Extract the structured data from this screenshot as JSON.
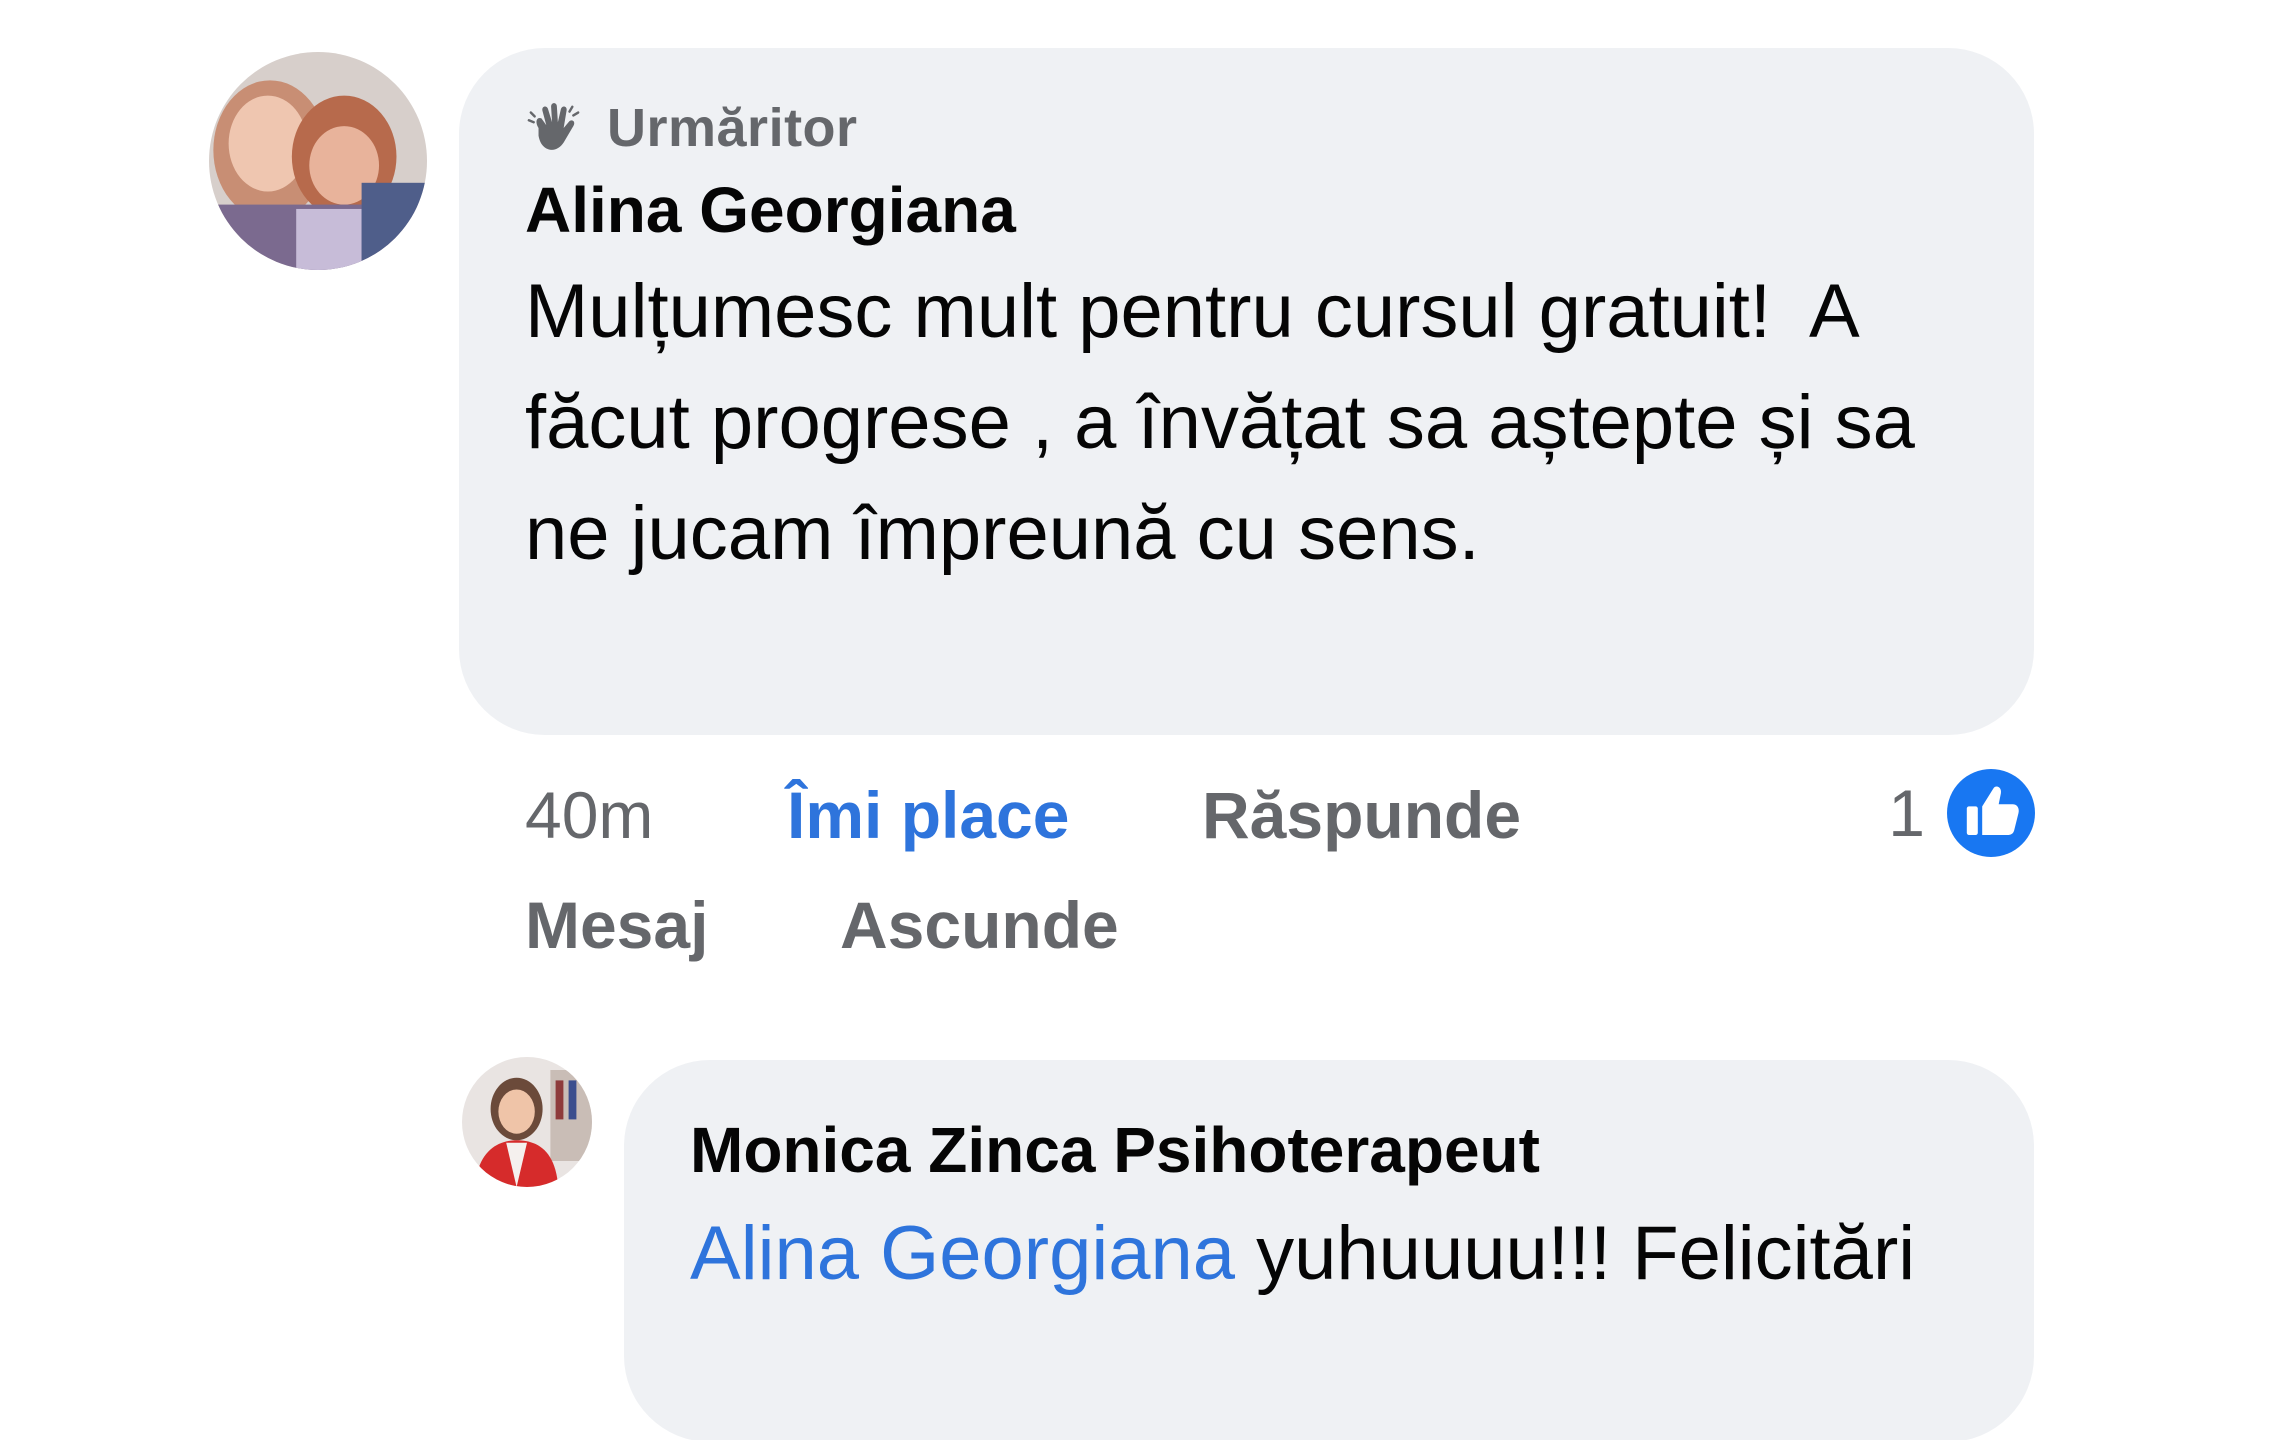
{
  "comment": {
    "badge": {
      "icon": "wave-hand-icon",
      "label": "Urmăritor"
    },
    "author": "Alina Georgiana",
    "text": "Mulțumesc mult pentru cursul gratuit!  A făcut progrese , a învățat sa aștepte și sa ne jucam împreună cu sens.",
    "actions": {
      "time": "40m",
      "like": "Îmi place",
      "reply": "Răspunde",
      "message": "Mesaj",
      "hide": "Ascunde"
    },
    "reactions": {
      "count": "1",
      "icon": "thumbs-up-icon"
    }
  },
  "reply": {
    "author": "Monica Zinca Psihoterapeut",
    "mention": "Alina Georgiana",
    "text": " yuhuuuu!!! Felicitări"
  },
  "colors": {
    "bubble": "#eff1f4",
    "link": "#2e74dc",
    "like_badge": "#1877f2",
    "muted_text": "#65676b",
    "text": "#050505"
  }
}
